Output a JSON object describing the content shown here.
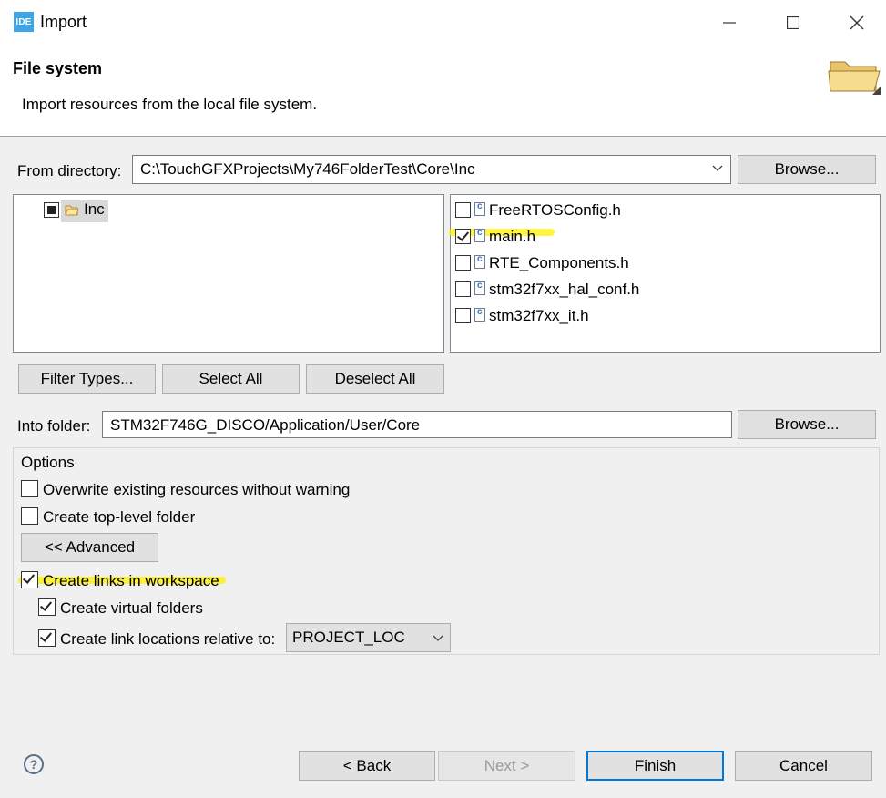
{
  "window": {
    "logo_text": "IDE",
    "title": "Import"
  },
  "header": {
    "title": "File system",
    "subtitle": "Import resources from the local file system."
  },
  "from_directory": {
    "label": "From directory:",
    "value": "C:\\TouchGFXProjects\\My746FolderTest\\Core\\Inc",
    "browse_label": "Browse..."
  },
  "tree": {
    "items": [
      {
        "label": "Inc",
        "state": "partial"
      }
    ]
  },
  "files": {
    "items": [
      {
        "label": "FreeRTOSConfig.h",
        "checked": false
      },
      {
        "label": "main.h",
        "checked": true
      },
      {
        "label": "RTE_Components.h",
        "checked": false
      },
      {
        "label": "stm32f7xx_hal_conf.h",
        "checked": false
      },
      {
        "label": "stm32f7xx_it.h",
        "checked": false
      }
    ]
  },
  "selection_buttons": {
    "filter_types": "Filter Types...",
    "select_all": "Select All",
    "deselect_all": "Deselect All"
  },
  "into_folder": {
    "label": "Into folder:",
    "value": "STM32F746G_DISCO/Application/User/Core",
    "browse_label": "Browse..."
  },
  "options": {
    "group_label": "Options",
    "overwrite": {
      "label": "Overwrite existing resources without warning",
      "checked": false
    },
    "top_level": {
      "label": "Create top-level folder",
      "checked": false
    },
    "advanced_button": "<< Advanced",
    "create_links": {
      "label": "Create links in workspace",
      "checked": true
    },
    "virtual_folders": {
      "label": "Create virtual folders",
      "checked": true
    },
    "relative_to": {
      "label": "Create link locations relative to:",
      "checked": true,
      "selected": "PROJECT_LOC"
    }
  },
  "footer": {
    "help_icon": "?",
    "back": "< Back",
    "next": "Next >",
    "finish": "Finish",
    "cancel": "Cancel"
  },
  "colors": {
    "highlight": "#fff000",
    "default_button_border": "#0078d7",
    "logo_bg": "#3ea6e8"
  }
}
